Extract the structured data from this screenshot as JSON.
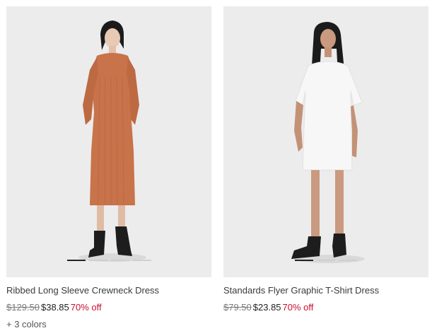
{
  "products": [
    {
      "name": "Ribbed Long Sleeve Crewneck Dress",
      "original_price": "$129.50",
      "sale_price": "$38.85",
      "discount": "70% off",
      "colors_link": "+ 3 colors",
      "image_slides": 4,
      "active_slide": 1
    },
    {
      "name": "Standards Flyer Graphic T-Shirt Dress",
      "original_price": "$79.50",
      "sale_price": "$23.85",
      "discount": "70% off",
      "image_slides": 3,
      "active_slide": 1
    }
  ],
  "colors": {
    "image_bg": "#ececed",
    "sale_red": "#c8102e",
    "dress_orange": "#c8734a",
    "dress_white": "#f7f7f7"
  }
}
